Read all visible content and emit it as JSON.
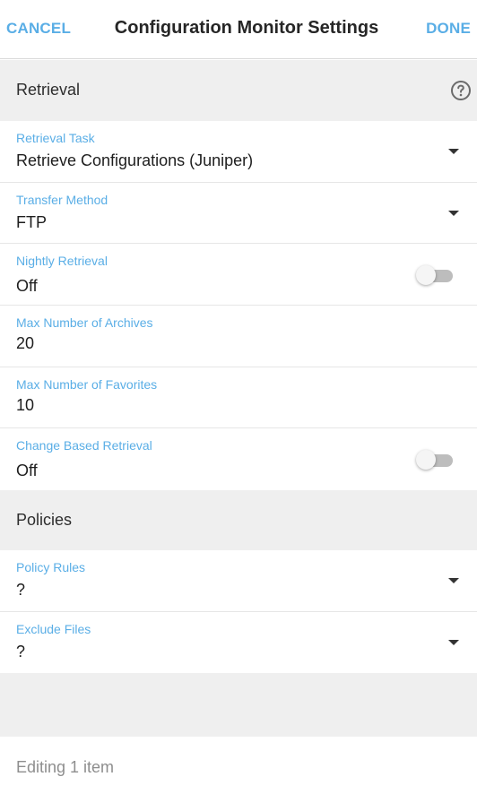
{
  "header": {
    "cancel_label": "CANCEL",
    "title": "Configuration Monitor Settings",
    "done_label": "DONE"
  },
  "sections": {
    "retrieval": {
      "label": "Retrieval",
      "help_icon": "help-circle-icon"
    },
    "policies": {
      "label": "Policies"
    }
  },
  "fields": {
    "retrieval_task": {
      "label": "Retrieval Task",
      "value": "Retrieve Configurations (Juniper)"
    },
    "transfer_method": {
      "label": "Transfer Method",
      "value": "FTP"
    },
    "nightly_retrieval": {
      "label": "Nightly Retrieval",
      "value": "Off",
      "enabled": false
    },
    "max_archives": {
      "label": "Max Number of Archives",
      "value": "20"
    },
    "max_favorites": {
      "label": "Max Number of Favorites",
      "value": "10"
    },
    "change_based_retrieval": {
      "label": "Change Based Retrieval",
      "value": "Off",
      "enabled": false
    },
    "policy_rules": {
      "label": "Policy Rules",
      "value": "?"
    },
    "exclude_files": {
      "label": "Exclude Files",
      "value": "?"
    }
  },
  "footer": {
    "status": "Editing 1 item"
  },
  "colors": {
    "accent": "#5aaee6",
    "section_bg": "#efefef",
    "toggle_off_track": "#bdbdbd"
  }
}
